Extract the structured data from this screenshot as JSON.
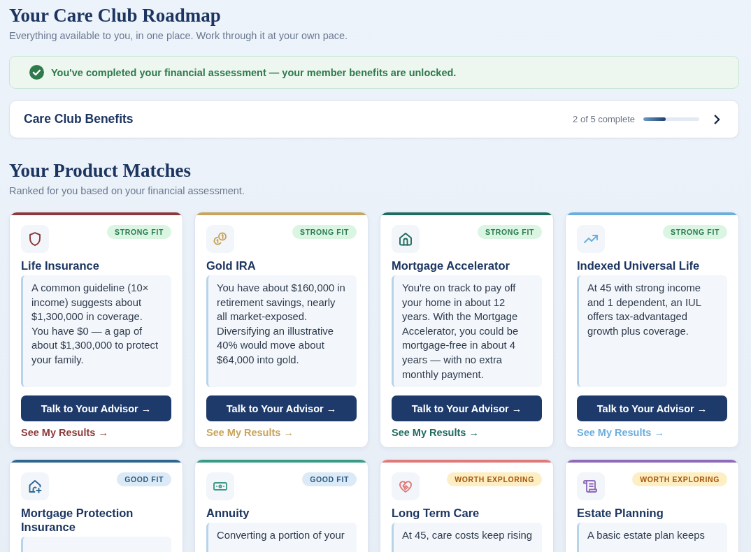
{
  "page": {
    "title": "Your Care Club Roadmap",
    "subtitle": "Everything available to you, in one place. Work through it at your own pace."
  },
  "banner": {
    "text": "You've completed your financial assessment — your member benefits are unlocked."
  },
  "benefits": {
    "title": "Care Club Benefits",
    "progress_text": "2 of 5 complete",
    "level": 0.4
  },
  "matches": {
    "title": "Your Product Matches",
    "subtitle": "Ranked for you based on your financial assessment.",
    "products": [
      {
        "name": "Life Insurance",
        "color": "#8b3a3a",
        "fit": {
          "label": "STRONG FIT",
          "kind": "strong"
        },
        "description": "A common guideline (10× income) suggests about $1,300,000 in coverage. You have $0 — a gap of about $1,300,000 to protect your family.",
        "button": "Talk to Your Advisor →",
        "link": "See My Results →"
      },
      {
        "name": "Gold IRA",
        "color": "#c9a45a",
        "fit": {
          "label": "STRONG FIT",
          "kind": "strong"
        },
        "description": "You have about $160,000 in retirement savings, nearly all market-exposed. Diversifying an illustrative 40% would move about $64,000 into gold.",
        "button": "Talk to Your Advisor →",
        "link": "See My Results →"
      },
      {
        "name": "Mortgage Accelerator",
        "color": "#1f6b5f",
        "fit": {
          "label": "STRONG FIT",
          "kind": "strong"
        },
        "description": "You're on track to pay off your home in about 12 years. With the Mortgage Accelerator, you could be mortgage-free in about 4 years — with no extra monthly payment.",
        "button": "Talk to Your Advisor →",
        "link": "See My Results →"
      },
      {
        "name": "Indexed Universal Life",
        "color": "#6aaede",
        "fit": {
          "label": "STRONG FIT",
          "kind": "strong"
        },
        "description": "At 45 with strong income and 1 dependent, an IUL offers tax-advantaged growth plus coverage.",
        "button": "Talk to Your Advisor →",
        "link": "See My Results →"
      },
      {
        "name": "Mortgage Protection Insurance",
        "color": "#2f6690",
        "fit": {
          "label": "GOOD FIT",
          "kind": "good"
        }
      },
      {
        "name": "Annuity",
        "color": "#3a9a86",
        "fit": {
          "label": "GOOD FIT",
          "kind": "good"
        },
        "description": "Converting a portion of your"
      },
      {
        "name": "Long Term Care",
        "color": "#e07a7a",
        "fit": {
          "label": "WORTH EXPLORING",
          "kind": "worth"
        },
        "description": "At 45, care costs keep rising"
      },
      {
        "name": "Estate Planning",
        "color": "#8e6bb8",
        "fit": {
          "label": "WORTH EXPLORING",
          "kind": "worth"
        },
        "description": "A basic estate plan keeps"
      }
    ]
  }
}
